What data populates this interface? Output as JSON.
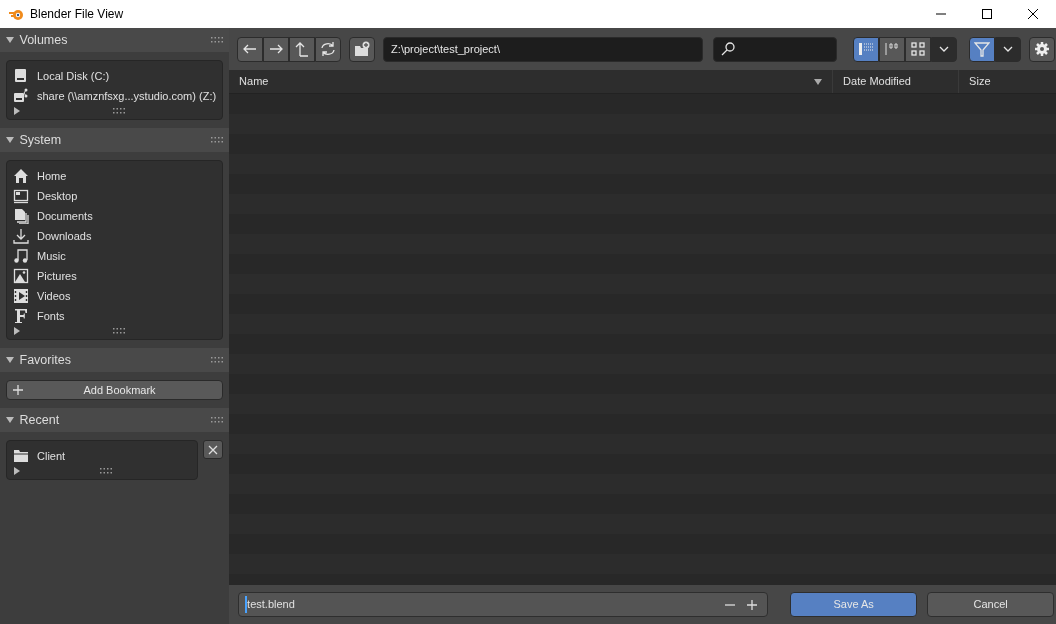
{
  "window": {
    "title": "Blender File View"
  },
  "sidebar": {
    "panels": [
      {
        "title": "Volumes",
        "expanded": true,
        "kind": "list",
        "items": [
          {
            "label": "Local Disk (C:)",
            "kind": "disk"
          },
          {
            "label": "share (\\\\amznfsxg...ystudio.com) (Z:)",
            "kind": "network"
          }
        ]
      },
      {
        "title": "System",
        "expanded": true,
        "kind": "list",
        "items": [
          {
            "label": "Home",
            "kind": "home"
          },
          {
            "label": "Desktop",
            "kind": "desktop"
          },
          {
            "label": "Documents",
            "kind": "documents"
          },
          {
            "label": "Downloads",
            "kind": "download"
          },
          {
            "label": "Music",
            "kind": "music"
          },
          {
            "label": "Pictures",
            "kind": "picture"
          },
          {
            "label": "Videos",
            "kind": "video"
          },
          {
            "label": "Fonts",
            "kind": "font"
          }
        ]
      },
      {
        "title": "Favorites",
        "expanded": true,
        "kind": "button",
        "button": "Add Bookmark"
      },
      {
        "title": "Recent",
        "expanded": true,
        "kind": "list",
        "clearable": true,
        "items": [
          {
            "label": "Client",
            "kind": "folder"
          }
        ]
      }
    ]
  },
  "toolbar": {
    "path": "Z:\\project\\test_project\\",
    "display_modes": [
      {
        "kind": "list",
        "selected": true
      },
      {
        "kind": "columns",
        "selected": false
      },
      {
        "kind": "grid",
        "selected": false
      }
    ],
    "filter_on": true
  },
  "file_list": {
    "columns": [
      {
        "label": "Name",
        "sorted": true
      },
      {
        "label": "Date Modified",
        "sorted": false
      },
      {
        "label": "Size",
        "sorted": false
      }
    ]
  },
  "footer": {
    "filename": "test.blend",
    "buttons": [
      {
        "label": "Save As",
        "primary": true
      },
      {
        "label": "Cancel",
        "primary": false
      }
    ]
  }
}
